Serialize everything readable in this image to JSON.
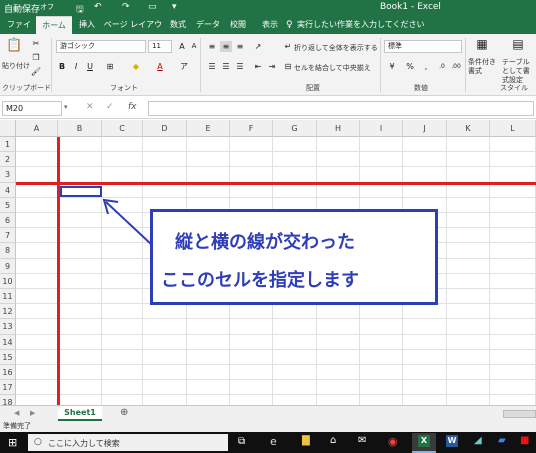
{
  "titlebar": {
    "autosave_label": "自動保存",
    "autosave_state": "オフ",
    "title": "Book1 - Excel"
  },
  "tabs": [
    {
      "label": "ファイル",
      "active": false
    },
    {
      "label": "ホーム",
      "active": true
    },
    {
      "label": "挿入",
      "active": false
    },
    {
      "label": "ページ レイアウト",
      "active": false
    },
    {
      "label": "数式",
      "active": false
    },
    {
      "label": "データ",
      "active": false
    },
    {
      "label": "校閲",
      "active": false
    },
    {
      "label": "表示",
      "active": false
    }
  ],
  "tell_me": "実行したい作業を入力してください",
  "ribbon": {
    "paste_label": "貼り付け",
    "font_name": "游ゴシック",
    "font_size": "11",
    "wrap_text": "折り返して全体を表示する",
    "merge_center": "セルを結合して中央揃え",
    "number_format": "標準",
    "conditional_format": "条件付き書式",
    "format_as_table": "テーブルとして書式設定",
    "groups": {
      "clipboard": "クリップボード",
      "font": "フォント",
      "alignment": "配置",
      "number": "数値",
      "styles": "スタイル"
    }
  },
  "formula_bar": {
    "name_box": "M20",
    "fx": "fx",
    "formula": ""
  },
  "columns": [
    "A",
    "B",
    "C",
    "D",
    "E",
    "F",
    "G",
    "H",
    "I",
    "J",
    "K",
    "L"
  ],
  "rows": [
    "1",
    "2",
    "3",
    "4",
    "5",
    "6",
    "7",
    "8",
    "9",
    "10",
    "11",
    "12",
    "13",
    "14",
    "15",
    "16",
    "17",
    "18"
  ],
  "callout": {
    "line1": "縦と横の線が交わった",
    "line2": "ここのセルを指定します"
  },
  "sheet_tab": "Sheet1",
  "status": "準備完了",
  "taskbar": {
    "search_placeholder": "ここに入力して検索"
  },
  "colors": {
    "excel_green": "#217346",
    "highlight_red": "#e02020",
    "callout_blue": "#2e3db8"
  }
}
